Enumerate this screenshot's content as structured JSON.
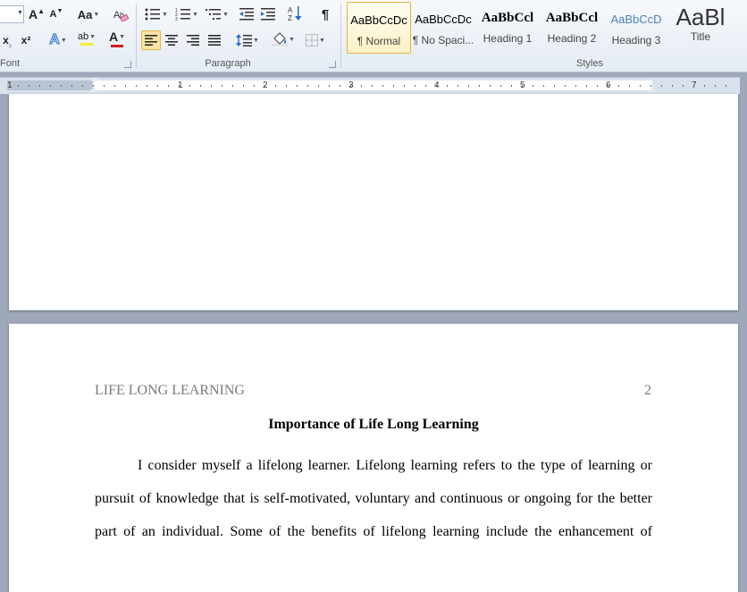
{
  "ribbon": {
    "font_group_label": "Font",
    "paragraph_group_label": "Paragraph",
    "styles_group_label": "Styles",
    "font": {
      "grow_font": "A",
      "shrink_font": "A",
      "change_case": "Aa",
      "subscript": "x",
      "superscript": "x²",
      "text_effects": "A",
      "highlight": "ab",
      "font_color": "A"
    },
    "paragraph": {
      "show_marks": "¶"
    },
    "styles": [
      {
        "sample": "AaBbCcDc",
        "name": "¶ Normal",
        "selected": true
      },
      {
        "sample": "AaBbCcDc",
        "name": "¶ No Spaci...",
        "selected": false
      },
      {
        "sample": "AaBbCcl",
        "name": "Heading 1",
        "selected": false
      },
      {
        "sample": "AaBbCcl",
        "name": "Heading 2",
        "selected": false
      },
      {
        "sample": "AaBbCcD",
        "name": "Heading 3",
        "selected": false
      },
      {
        "sample": "AaBl",
        "name": "Title",
        "selected": false
      }
    ]
  },
  "ruler": {
    "numbers": [
      "1",
      "1",
      "2",
      "3",
      "4",
      "5",
      "6",
      "7"
    ]
  },
  "document": {
    "header_title": "LIFE LONG LEARNING",
    "header_page_number": "2",
    "heading": "Importance of Life Long Learning",
    "lines": [
      "I consider myself a lifelong learner.  Lifelong learning refers to the type of learning or",
      "pursuit of knowledge that is self-motivated, voluntary and continuous or ongoing for the better",
      "part of an individual. Some of the benefits of lifelong learning include the enhancement of"
    ]
  },
  "colors": {
    "accent_active": "#fce4a6",
    "font_color_bar": "#d21f1f",
    "highlight_bar": "#f4ef27",
    "heading3_blue": "#4f81bd"
  }
}
